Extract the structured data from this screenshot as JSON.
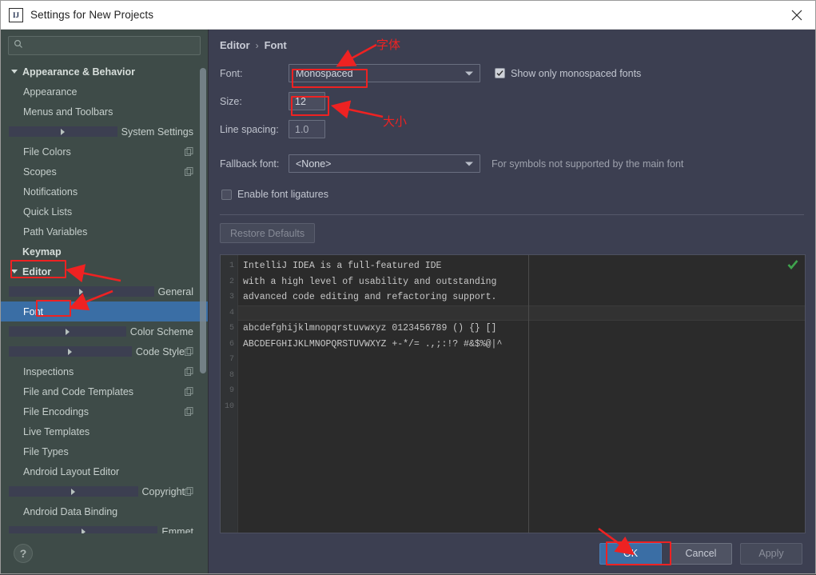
{
  "window": {
    "title": "Settings for New Projects",
    "app_icon": "intellij-idea-icon",
    "close_icon": "close-icon"
  },
  "sidebar": {
    "search": {
      "placeholder": "",
      "value": "",
      "icon": "search-icon"
    },
    "help_label": "?",
    "items": [
      {
        "label": "Appearance & Behavior",
        "level": 0,
        "twisty": "down",
        "bold": true,
        "badge": false,
        "selected": false
      },
      {
        "label": "Appearance",
        "level": 1,
        "twisty": "none",
        "bold": false,
        "badge": false,
        "selected": false
      },
      {
        "label": "Menus and Toolbars",
        "level": 1,
        "twisty": "none",
        "bold": false,
        "badge": false,
        "selected": false
      },
      {
        "label": "System Settings",
        "level": 1,
        "twisty": "right",
        "bold": false,
        "badge": false,
        "selected": false
      },
      {
        "label": "File Colors",
        "level": 1,
        "twisty": "none",
        "bold": false,
        "badge": true,
        "selected": false
      },
      {
        "label": "Scopes",
        "level": 1,
        "twisty": "none",
        "bold": false,
        "badge": true,
        "selected": false
      },
      {
        "label": "Notifications",
        "level": 1,
        "twisty": "none",
        "bold": false,
        "badge": false,
        "selected": false
      },
      {
        "label": "Quick Lists",
        "level": 1,
        "twisty": "none",
        "bold": false,
        "badge": false,
        "selected": false
      },
      {
        "label": "Path Variables",
        "level": 1,
        "twisty": "none",
        "bold": false,
        "badge": false,
        "selected": false
      },
      {
        "label": "Keymap",
        "level": 0,
        "twisty": "none",
        "bold": true,
        "badge": false,
        "selected": false
      },
      {
        "label": "Editor",
        "level": 0,
        "twisty": "down",
        "bold": true,
        "badge": false,
        "selected": false
      },
      {
        "label": "General",
        "level": 1,
        "twisty": "right",
        "bold": false,
        "badge": false,
        "selected": false
      },
      {
        "label": "Font",
        "level": 1,
        "twisty": "none",
        "bold": false,
        "badge": false,
        "selected": true
      },
      {
        "label": "Color Scheme",
        "level": 1,
        "twisty": "right",
        "bold": false,
        "badge": false,
        "selected": false
      },
      {
        "label": "Code Style",
        "level": 1,
        "twisty": "right",
        "bold": false,
        "badge": true,
        "selected": false
      },
      {
        "label": "Inspections",
        "level": 1,
        "twisty": "none",
        "bold": false,
        "badge": true,
        "selected": false
      },
      {
        "label": "File and Code Templates",
        "level": 1,
        "twisty": "none",
        "bold": false,
        "badge": true,
        "selected": false
      },
      {
        "label": "File Encodings",
        "level": 1,
        "twisty": "none",
        "bold": false,
        "badge": true,
        "selected": false
      },
      {
        "label": "Live Templates",
        "level": 1,
        "twisty": "none",
        "bold": false,
        "badge": false,
        "selected": false
      },
      {
        "label": "File Types",
        "level": 1,
        "twisty": "none",
        "bold": false,
        "badge": false,
        "selected": false
      },
      {
        "label": "Android Layout Editor",
        "level": 1,
        "twisty": "none",
        "bold": false,
        "badge": false,
        "selected": false
      },
      {
        "label": "Copyright",
        "level": 1,
        "twisty": "right",
        "bold": false,
        "badge": true,
        "selected": false
      },
      {
        "label": "Android Data Binding",
        "level": 1,
        "twisty": "none",
        "bold": false,
        "badge": false,
        "selected": false
      },
      {
        "label": "Emmet",
        "level": 1,
        "twisty": "right",
        "bold": false,
        "badge": false,
        "selected": false
      }
    ]
  },
  "breadcrumb": {
    "root": "Editor",
    "separator": "›",
    "leaf": "Font"
  },
  "form": {
    "font_label": "Font:",
    "font_value": "Monospaced",
    "show_monospaced_label": "Show only monospaced fonts",
    "show_monospaced_checked": true,
    "size_label": "Size:",
    "size_value": "12",
    "line_spacing_label": "Line spacing:",
    "line_spacing_value": "1.0",
    "fallback_label": "Fallback font:",
    "fallback_value": "<None>",
    "fallback_hint": "For symbols not supported by the main font",
    "ligatures_label": "Enable font ligatures",
    "ligatures_checked": false,
    "restore_defaults_label": "Restore Defaults"
  },
  "preview": {
    "gutter_numbers": [
      "1",
      "2",
      "3",
      "4",
      "5",
      "6",
      "7",
      "8",
      "9",
      "10"
    ],
    "lines": [
      "IntelliJ IDEA is a full-featured IDE",
      "with a high level of usability and outstanding",
      "advanced code editing and refactoring support.",
      "",
      "abcdefghijklmnopqrstuvwxyz 0123456789 () {} []",
      "ABCDEFGHIJKLMNOPQRSTUVWXYZ +-*/= .,;:!? #&$%@|^"
    ],
    "caret_line": 4,
    "status_icon": "green-check-icon"
  },
  "buttons": {
    "ok": "OK",
    "cancel": "Cancel",
    "apply": "Apply"
  },
  "annotations": {
    "font_note": "字体",
    "size_note": "大小",
    "color": "#ee2222"
  }
}
